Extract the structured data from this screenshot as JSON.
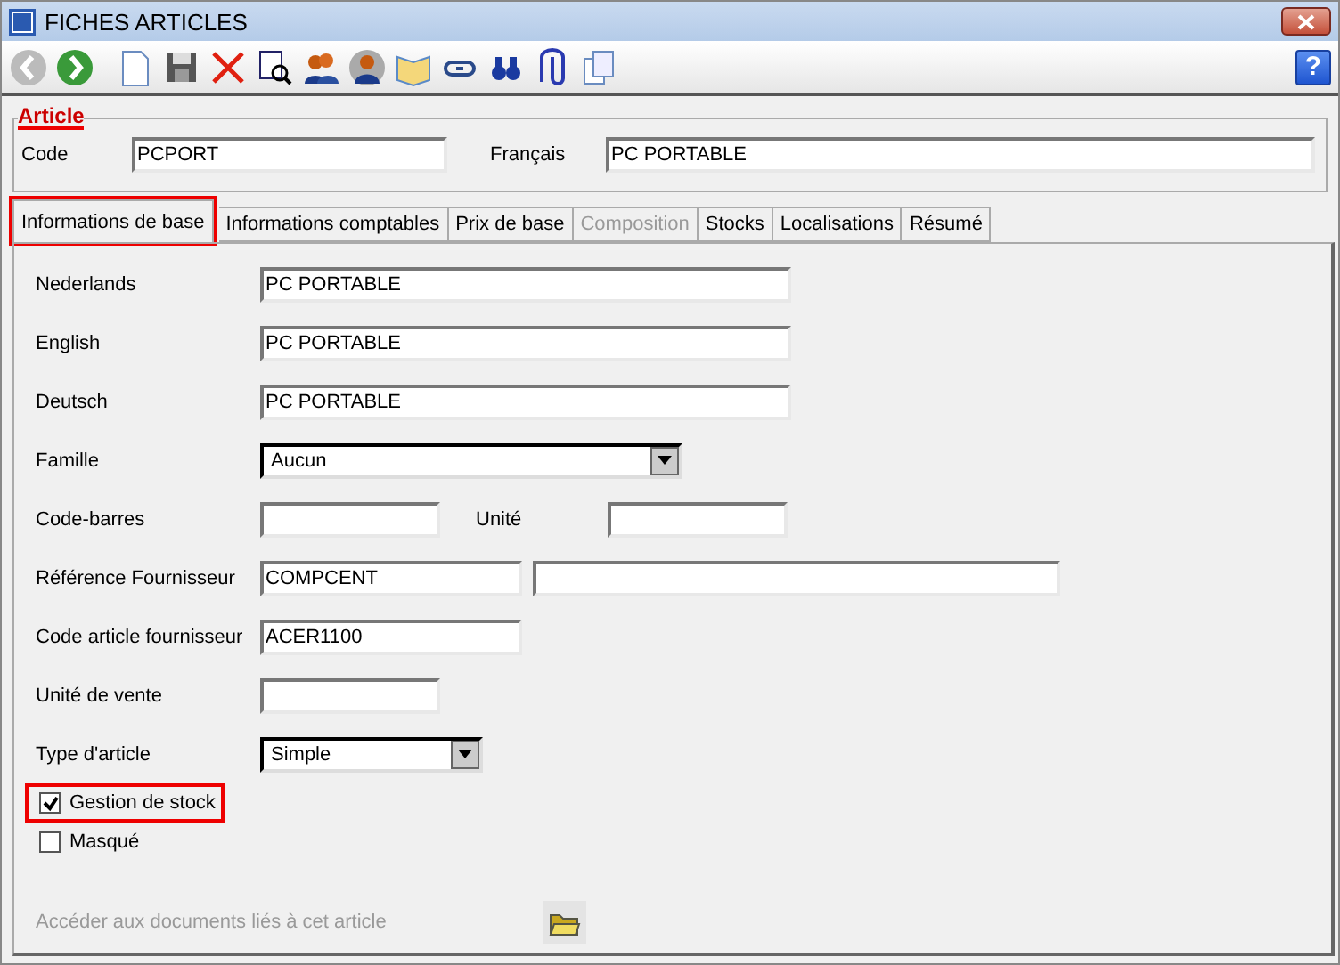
{
  "window": {
    "title": "FICHES ARTICLES"
  },
  "toolbar": {
    "nav": [
      {
        "kind": "back",
        "disabled": true
      },
      {
        "kind": "forward",
        "disabled": false
      }
    ],
    "help": "?"
  },
  "article": {
    "legend": "Article",
    "code_label": "Code",
    "code_value": "PCPORT",
    "fr_label": "Français",
    "fr_value": "PC PORTABLE"
  },
  "tabs": [
    {
      "label": "Informations de base",
      "selected": true,
      "disabled": false,
      "highlighted": true
    },
    {
      "label": "Informations comptables",
      "selected": false,
      "disabled": false,
      "highlighted": false
    },
    {
      "label": "Prix de base",
      "selected": false,
      "disabled": false,
      "highlighted": false
    },
    {
      "label": "Composition",
      "selected": false,
      "disabled": true,
      "highlighted": false
    },
    {
      "label": "Stocks",
      "selected": false,
      "disabled": false,
      "highlighted": false
    },
    {
      "label": "Localisations",
      "selected": false,
      "disabled": false,
      "highlighted": false
    },
    {
      "label": "Résumé",
      "selected": false,
      "disabled": false,
      "highlighted": false
    }
  ],
  "fields": [
    {
      "kind": "long",
      "label": "Nederlands",
      "value": "PC PORTABLE"
    },
    {
      "kind": "long",
      "label": "English",
      "value": "PC PORTABLE"
    },
    {
      "kind": "long",
      "label": "Deutsch",
      "value": "PC PORTABLE"
    },
    {
      "kind": "select",
      "label": "Famille",
      "value": "Aucun"
    },
    {
      "kind": "pair",
      "label": "Code-barres",
      "label2": "Unité"
    },
    {
      "kind": "double",
      "label": "Référence Fournisseur",
      "value": "COMPCENT"
    },
    {
      "kind": "medium",
      "label": "Code article fournisseur",
      "value": "ACER1100"
    },
    {
      "kind": "short",
      "label": "Unité de vente"
    },
    {
      "kind": "smallselect",
      "label": "Type d'article",
      "value": "Simple"
    }
  ],
  "checkboxes": [
    {
      "label": "Gestion de stock",
      "checked": true,
      "highlighted": true
    },
    {
      "label": "Masqué",
      "checked": false,
      "highlighted": false
    }
  ],
  "documents_link": "Accéder aux documents liés à cet article"
}
